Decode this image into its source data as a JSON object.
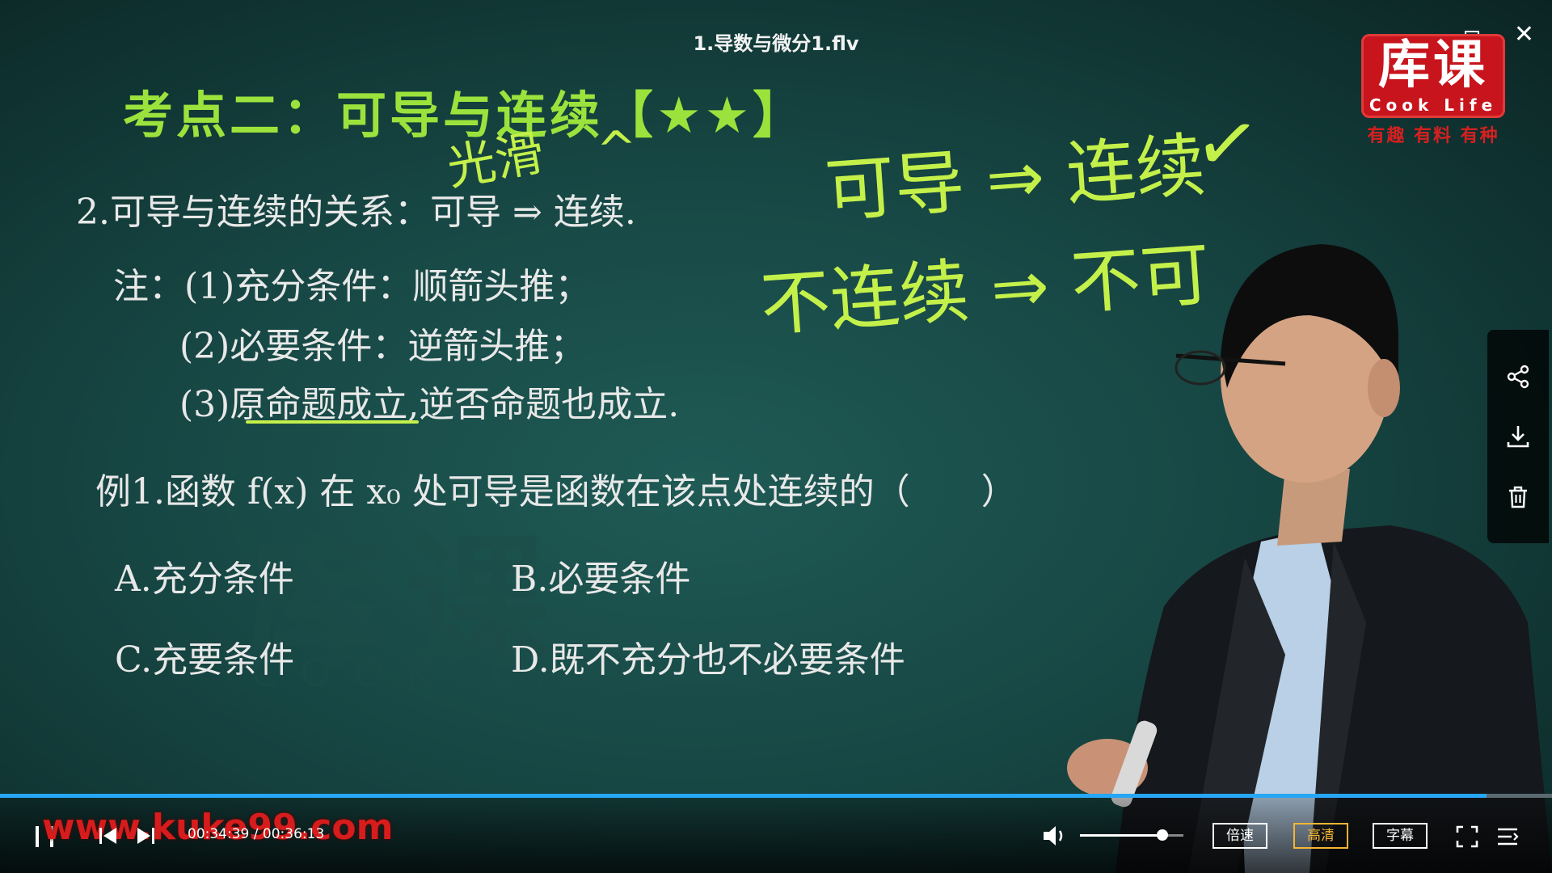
{
  "player": {
    "file_title": "1.导数与微分1.flv",
    "close_glyph": "✕",
    "current_time": "00:34:39",
    "total_time": "00:36:13",
    "time_separator": " / ",
    "progress_fraction": 0.958,
    "volume_fraction": 0.8,
    "speed_label": "倍速",
    "quality_label": "高清",
    "subtitle_label": "字幕",
    "accent_color": "#27a6f5",
    "active_color": "#f5b634"
  },
  "logo": {
    "big": "库课",
    "small": "Cook Life",
    "slogan": "有趣 有料 有种"
  },
  "site_watermark": "www.kuke99.com",
  "slide": {
    "heading": "考点二：可导与连续【★★】",
    "relation": "2.可导与连续的关系：可导 ⇒ 连续.",
    "note1": "注：(1)充分条件：顺箭头推；",
    "note2": "(2)必要条件：逆箭头推；",
    "note3": "(3)原命题成立,逆否命题也成立.",
    "example": "例1.函数 f(x) 在 x₀ 处可导是函数在该点处连续的（　　）",
    "option_a": "A.充分条件",
    "option_b": "B.必要条件",
    "option_c": "C.充要条件",
    "option_d": "D.既不充分也不必要条件"
  },
  "handwriting": {
    "smooth": "光滑",
    "line1": "可导 ⇒ 连续",
    "check": "✓",
    "line2": "不连续 ⇒ 不可"
  },
  "side_panel": {
    "icons": [
      "share-icon",
      "download-icon",
      "trash-icon"
    ]
  }
}
